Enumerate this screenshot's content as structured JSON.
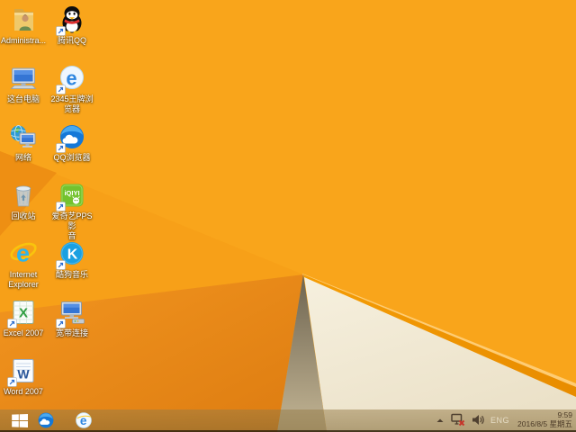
{
  "wallpaper": {
    "base": "#F9A51B",
    "facet": "#F7A018",
    "wedge": "#EE8F13",
    "dark_start": "#F2951F",
    "dark_end": "#DD7C11",
    "shadow_start": "#6E6450",
    "shadow_end": "#C3B594",
    "cream_start": "#F6F0DE",
    "cream_end": "#EBE1C8",
    "stripe_start": "#F59D05",
    "stripe_end": "#E88C00",
    "stripe_highlight": "#FFD993"
  },
  "desktop": {
    "icons": [
      {
        "name": "administrator-folder",
        "label": "Administra...",
        "icon": "user-folder-icon",
        "shortcut": false
      },
      {
        "name": "tencent-qq",
        "label": "腾讯QQ",
        "icon": "qq-penguin-icon",
        "shortcut": true
      },
      {
        "name": "this-pc",
        "label": "这台电脑",
        "icon": "computer-icon",
        "shortcut": false
      },
      {
        "name": "2345-browser",
        "label": "2345王牌浏\n览器",
        "icon": "browser-e-icon",
        "shortcut": true
      },
      {
        "name": "network",
        "label": "网络",
        "icon": "network-globe-icon",
        "shortcut": false
      },
      {
        "name": "qq-browser",
        "label": "QQ浏览器",
        "icon": "qq-browser-icon",
        "shortcut": true
      },
      {
        "name": "recycle-bin",
        "label": "回收站",
        "icon": "recycle-bin-icon",
        "shortcut": false
      },
      {
        "name": "iqiyi-pps",
        "label": "爱奇艺PPS 影\n音",
        "icon": "iqiyi-icon",
        "shortcut": true
      },
      {
        "name": "internet-explorer",
        "label": "Internet\nExplorer",
        "icon": "ie-icon",
        "shortcut": false
      },
      {
        "name": "kugou-music",
        "label": "酷狗音乐",
        "icon": "kugou-icon",
        "shortcut": true
      },
      {
        "name": "excel-2007",
        "label": "Excel 2007",
        "icon": "excel-icon",
        "shortcut": true
      },
      {
        "name": "broadband-connection",
        "label": "宽带连接",
        "icon": "broadband-icon",
        "shortcut": true
      },
      {
        "name": "word-2007",
        "label": "Word 2007",
        "icon": "word-icon",
        "shortcut": true
      }
    ]
  },
  "taskbar": {
    "tint": "#8F764A",
    "pinned": [
      {
        "name": "qq-browser",
        "icon": "qq-browser-icon"
      },
      {
        "name": "internet-explorer",
        "icon": "ie-icon"
      }
    ],
    "tray": {
      "language": "ENG",
      "time": "9:59",
      "date": "2016/8/5 星期五",
      "icons": [
        "show-hidden-icons",
        "network-disconnected",
        "volume"
      ],
      "text_color": "#4D3B28",
      "language_color": "#E6DEC6"
    }
  }
}
